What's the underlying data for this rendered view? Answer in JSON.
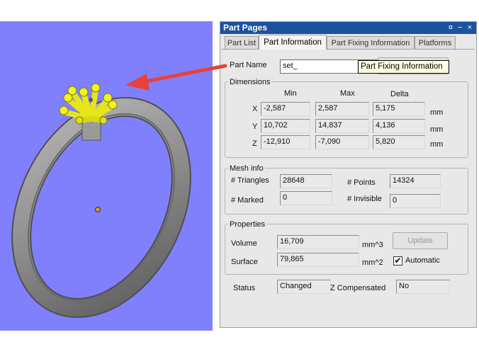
{
  "panel": {
    "title": "Part Pages",
    "title_buttons": "¤ − ×"
  },
  "tabs": [
    {
      "label": "Part List",
      "active": false
    },
    {
      "label": "Part Information",
      "active": true
    },
    {
      "label": "Part Fixing Information",
      "active": false
    },
    {
      "label": "Platforms",
      "active": false
    }
  ],
  "part_name": {
    "label": "Part Name",
    "value": "set_"
  },
  "tooltip": "Part Fixing Information",
  "dimensions": {
    "group_label": "Dimensions",
    "headers": {
      "min": "Min",
      "max": "Max",
      "delta": "Delta"
    },
    "unit": "mm",
    "rows": [
      {
        "axis": "X",
        "min": "-2,587",
        "max": "2,587",
        "delta": "5,175"
      },
      {
        "axis": "Y",
        "min": "10,702",
        "max": "14,837",
        "delta": "4,136"
      },
      {
        "axis": "Z",
        "min": "-12,910",
        "max": "-7,090",
        "delta": "5,820"
      }
    ]
  },
  "mesh": {
    "group_label": "Mesh info",
    "triangles_label": "# Triangles",
    "triangles": "28648",
    "points_label": "# Points",
    "points": "14324",
    "marked_label": "# Marked",
    "marked": "0",
    "invisible_label": "# Invisible",
    "invisible": "0"
  },
  "properties": {
    "group_label": "Properties",
    "volume_label": "Volume",
    "volume": "16,709",
    "volume_unit": "mm^3",
    "surface_label": "Surface",
    "surface": "79,865",
    "surface_unit": "mm^2",
    "update_label": "Update",
    "automatic_label": "Automatic",
    "automatic_checked": true,
    "check_mark": "✔"
  },
  "status": {
    "label": "Status",
    "value": "Changed",
    "z_label": "Z Compensated",
    "z_value": "No"
  },
  "colors": {
    "viewport_bg": "#8080fc",
    "titlebar": "#1b52a0",
    "arrow": "#e8413a",
    "ring": "#8a8a8a",
    "support": "#f2f21e"
  }
}
